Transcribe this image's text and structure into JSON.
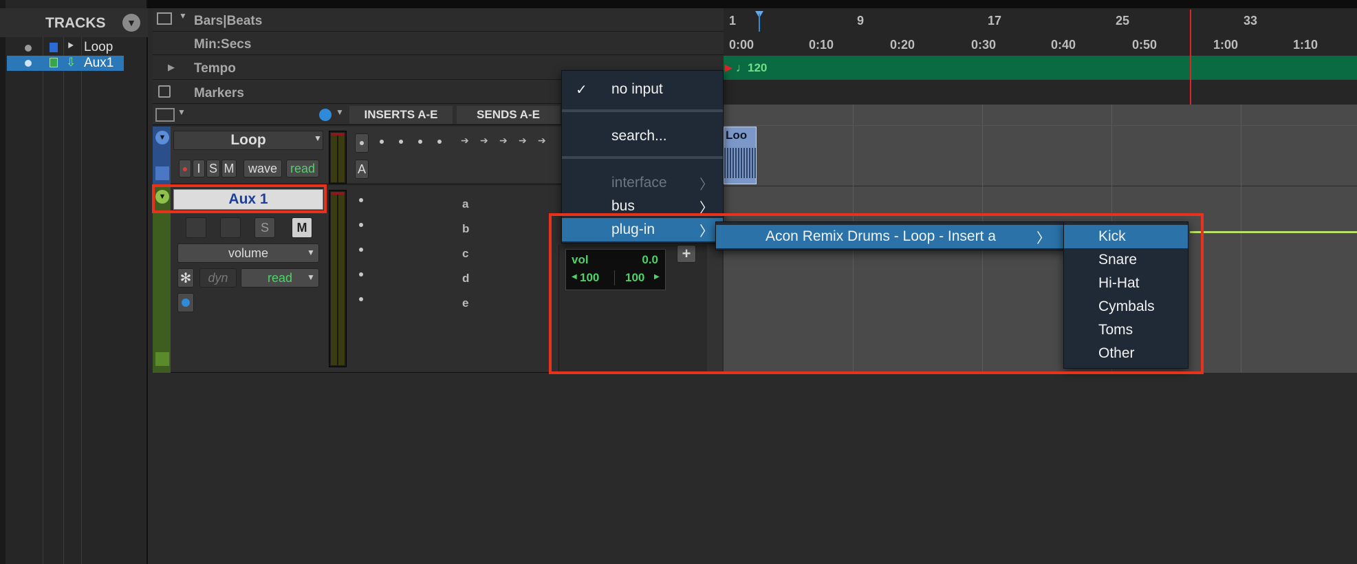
{
  "tracks_panel": {
    "title": "TRACKS",
    "items": [
      {
        "name": "Loop",
        "selected": false,
        "color": "#2a6bd6"
      },
      {
        "name": "Aux1",
        "selected": true,
        "color": "#3aa548"
      }
    ]
  },
  "rulers": {
    "bars_beats_label": "Bars|Beats",
    "min_secs_label": "Min:Secs",
    "tempo_label": "Tempo",
    "markers_label": "Markers",
    "bars": [
      "1",
      "9",
      "17",
      "25",
      "33"
    ],
    "secs": [
      "0:00",
      "0:10",
      "0:20",
      "0:30",
      "0:40",
      "0:50",
      "1:00",
      "1:10"
    ],
    "tempo_value": "120"
  },
  "mix_header": {
    "inserts_label": "INSERTS A-E",
    "sends_label": "SENDS A-E"
  },
  "track_loop": {
    "name": "Loop",
    "rec": "●",
    "input": "I",
    "solo": "S",
    "mute": "M",
    "view": "wave",
    "automation": "read",
    "insert_a_label": "A",
    "clip_label": "Loo"
  },
  "track_aux": {
    "name": "Aux 1",
    "solo": "S",
    "mute": "M",
    "view": "volume",
    "dyn": "dyn",
    "automation": "read",
    "sends": [
      "a",
      "b",
      "c",
      "d",
      "e"
    ],
    "vol_label": "vol",
    "vol_value": "0.0",
    "pan_left": "100",
    "pan_right": "100"
  },
  "input_menu": {
    "items": [
      {
        "label": "no input",
        "checked": true
      },
      {
        "label": "search..."
      },
      {
        "label": "interface",
        "disabled": true
      },
      {
        "label": "bus"
      },
      {
        "label": "plug-in",
        "selected": true
      }
    ],
    "check": "✓"
  },
  "plugin_submenu": {
    "item": "Acon Remix Drums - Loop - Insert a"
  },
  "drum_submenu": {
    "items": [
      "Kick",
      "Snare",
      "Hi-Hat",
      "Cymbals",
      "Toms",
      "Other"
    ],
    "selected": "Kick"
  },
  "colors": {
    "highlight": "#e8321c",
    "menu_selected": "#2a72a8",
    "tempo_bar": "#0a6b42",
    "playhead": "#e0242a",
    "aux_green": "#3d5e1f"
  }
}
